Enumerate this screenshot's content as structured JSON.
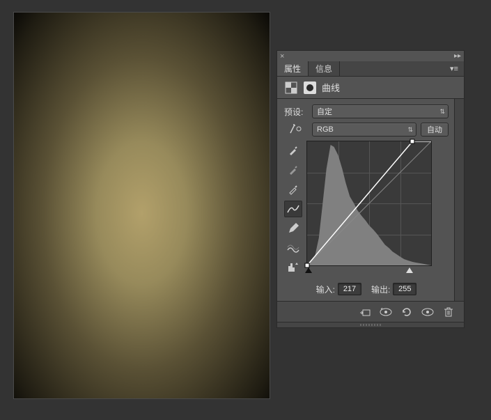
{
  "tabs": {
    "properties": "属性",
    "info": "信息"
  },
  "adjustment": {
    "title": "曲线"
  },
  "preset": {
    "label": "预设:",
    "value": "自定"
  },
  "channel": {
    "value": "RGB",
    "auto_label": "自动"
  },
  "io": {
    "input_label": "输入:",
    "input_value": "217",
    "output_label": "输出:",
    "output_value": "255"
  },
  "icons": {
    "close": "×",
    "expand": "▸▸",
    "menu": "▾≡",
    "curves_adj": "⧄",
    "chev_updown": "⇅",
    "hand": "☞",
    "eyedrop_b": "✎",
    "eyedrop_g": "✎",
    "eyedrop_w": "✎",
    "curve_tool": "∿",
    "pencil": "✏",
    "smooth": "≋",
    "clip": "◧",
    "eye_prev": "◉",
    "reset": "↺",
    "eye": "◉",
    "trash": "🗑"
  },
  "chart_data": {
    "type": "curve",
    "grid": 4,
    "histogram_bins": [
      5,
      12,
      40,
      85,
      140,
      175,
      172,
      160,
      140,
      120,
      100,
      90,
      80,
      70,
      62,
      55,
      48,
      42,
      35,
      30,
      25,
      20,
      16,
      12,
      9,
      7,
      5,
      4,
      3,
      2,
      2,
      1
    ],
    "curve_points": [
      {
        "input": 0,
        "output": 0
      },
      {
        "input": 217,
        "output": 255
      }
    ],
    "xlim": [
      0,
      255
    ],
    "ylim": [
      0,
      255
    ]
  }
}
